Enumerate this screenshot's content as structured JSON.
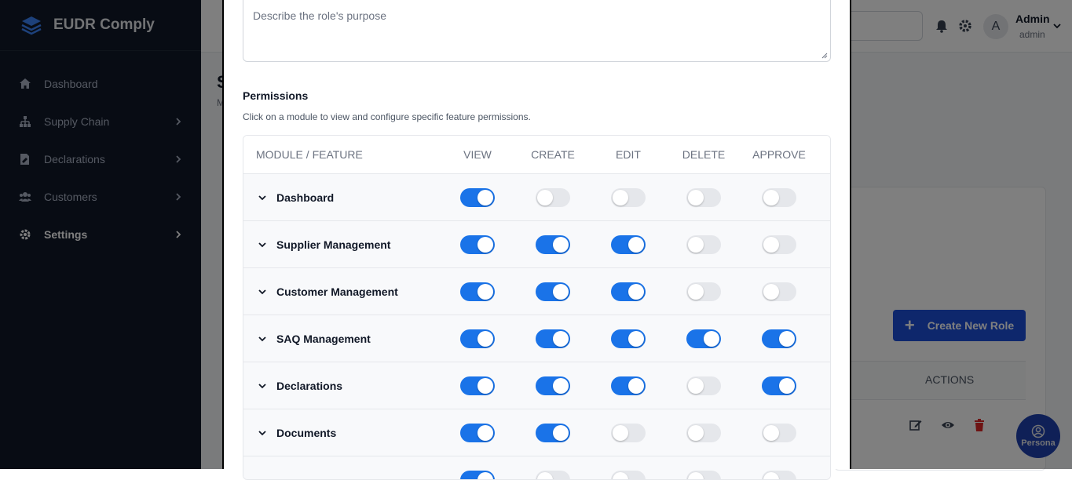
{
  "app": {
    "name": "EUDR Comply"
  },
  "sidebar": {
    "items": [
      {
        "label": "Dashboard",
        "icon": "home-icon",
        "has_chevron": false,
        "active": false
      },
      {
        "label": "Supply Chain",
        "icon": "hierarchy-icon",
        "has_chevron": true,
        "active": false
      },
      {
        "label": "Declarations",
        "icon": "file-signature-icon",
        "has_chevron": true,
        "active": false
      },
      {
        "label": "Customers",
        "icon": "users-icon",
        "has_chevron": true,
        "active": false
      },
      {
        "label": "Settings",
        "icon": "gear-icon",
        "has_chevron": true,
        "active": true
      }
    ]
  },
  "header": {
    "avatar_initial": "A",
    "user_name": "Admin",
    "user_role": "admin"
  },
  "background_page": {
    "title_stub": "S",
    "subtitle_stub": "M",
    "create_button": "Create New Role",
    "actions_header": "ACTIONS",
    "fab_label": "Persona"
  },
  "modal": {
    "description_placeholder": "Describe the role's purpose",
    "permissions_title": "Permissions",
    "permissions_subtitle": "Click on a module to view and configure specific feature permissions.",
    "columns": [
      "MODULE / FEATURE",
      "VIEW",
      "CREATE",
      "EDIT",
      "DELETE",
      "APPROVE"
    ],
    "rows": [
      {
        "module": "Dashboard",
        "view": true,
        "create": false,
        "edit": false,
        "delete": false,
        "approve": false
      },
      {
        "module": "Supplier Management",
        "view": true,
        "create": true,
        "edit": true,
        "delete": false,
        "approve": false
      },
      {
        "module": "Customer Management",
        "view": true,
        "create": true,
        "edit": true,
        "delete": false,
        "approve": false
      },
      {
        "module": "SAQ Management",
        "view": true,
        "create": true,
        "edit": true,
        "delete": true,
        "approve": true
      },
      {
        "module": "Declarations",
        "view": true,
        "create": true,
        "edit": true,
        "delete": false,
        "approve": true
      },
      {
        "module": "Documents",
        "view": true,
        "create": true,
        "edit": false,
        "delete": false,
        "approve": false
      },
      {
        "module": "",
        "view": true,
        "create": false,
        "edit": false,
        "delete": false,
        "approve": false
      }
    ]
  },
  "colors": {
    "toggle_on": "#1a73e8",
    "toggle_off": "#e5e7eb",
    "sidebar_bg": "#101828",
    "primary_button": "#1d4ed8"
  }
}
